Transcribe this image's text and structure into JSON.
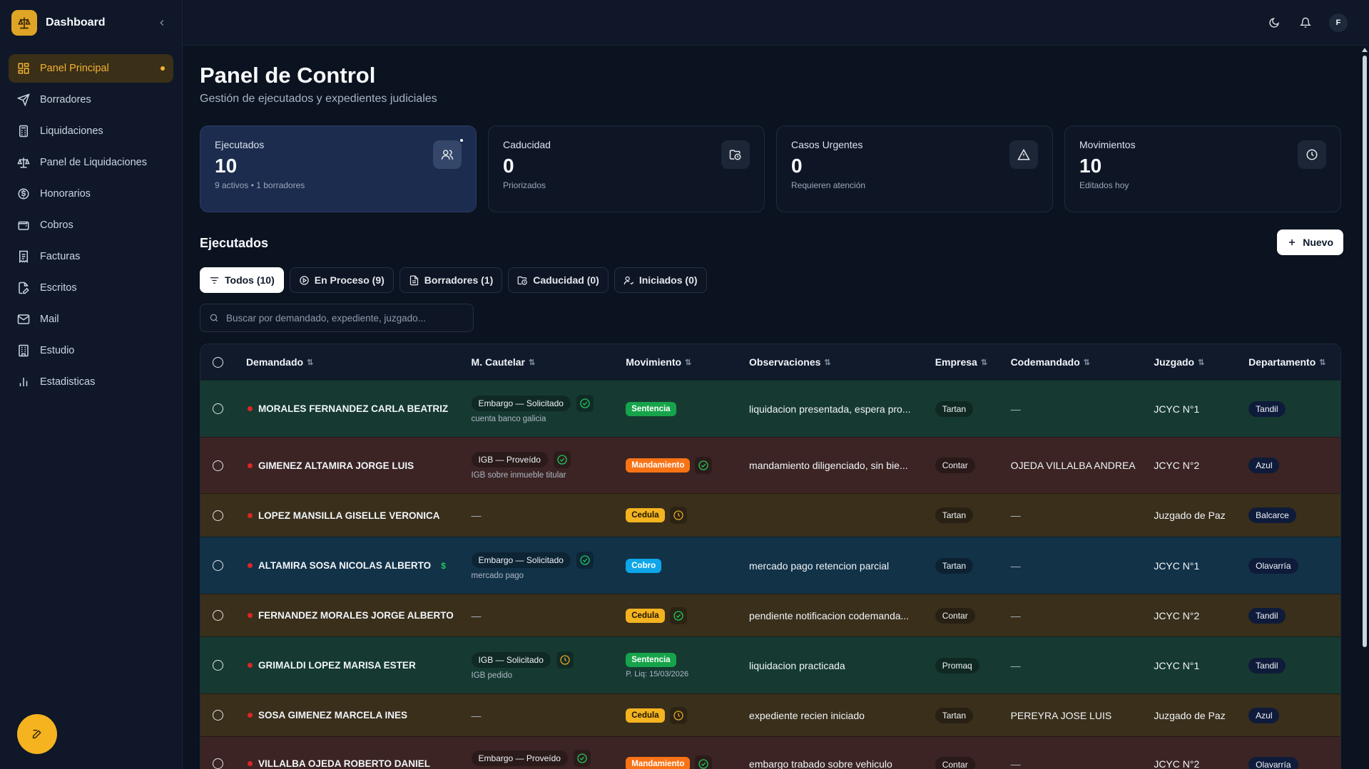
{
  "sidebar": {
    "brand": "Dashboard",
    "items": [
      {
        "label": "Panel Principal",
        "icon": "grid-icon"
      },
      {
        "label": "Borradores",
        "icon": "send-icon"
      },
      {
        "label": "Liquidaciones",
        "icon": "calculator-icon"
      },
      {
        "label": "Panel de Liquidaciones",
        "icon": "scale-icon"
      },
      {
        "label": "Honorarios",
        "icon": "dollar-circle-icon"
      },
      {
        "label": "Cobros",
        "icon": "wallet-icon"
      },
      {
        "label": "Facturas",
        "icon": "receipt-icon"
      },
      {
        "label": "Escritos",
        "icon": "file-pen-icon"
      },
      {
        "label": "Mail",
        "icon": "mail-icon"
      },
      {
        "label": "Estudio",
        "icon": "building-icon"
      },
      {
        "label": "Estadisticas",
        "icon": "bar-chart-icon"
      }
    ]
  },
  "topbar": {
    "avatar": "F"
  },
  "page": {
    "title": "Panel de Control",
    "subtitle": "Gestión de ejecutados y expedientes judiciales"
  },
  "stats": [
    {
      "label": "Ejecutados",
      "value": "10",
      "sub": "9 activos • 1 borradores"
    },
    {
      "label": "Caducidad",
      "value": "0",
      "sub": "Priorizados"
    },
    {
      "label": "Casos Urgentes",
      "value": "0",
      "sub": "Requieren atención"
    },
    {
      "label": "Movimientos",
      "value": "10",
      "sub": "Editados hoy"
    }
  ],
  "section": {
    "title": "Ejecutados",
    "new_label": "Nuevo"
  },
  "filters": [
    {
      "label": "Todos (10)"
    },
    {
      "label": "En Proceso (9)"
    },
    {
      "label": "Borradores (1)"
    },
    {
      "label": "Caducidad (0)"
    },
    {
      "label": "Iniciados (0)"
    }
  ],
  "search": {
    "placeholder": "Buscar por demandado, expediente, juzgado..."
  },
  "table": {
    "headers": [
      "Demandado",
      "M. Cautelar",
      "Movimiento",
      "Observaciones",
      "Empresa",
      "Codemandado",
      "Juzgado",
      "Departamento"
    ],
    "rows": [
      {
        "demandado": "MORALES FERNANDEZ CARLA BEATRIZ",
        "cautelar": "Embargo — Solicitado",
        "cautelar_sub": "cuenta banco galicia",
        "movimiento": "Sentencia",
        "mov_sub": "",
        "observaciones": "liquidacion presentada, espera pro...",
        "empresa": "Tartan",
        "codemandado": "—",
        "juzgado": "JCYC N°1",
        "departamento": "Tandil"
      },
      {
        "demandado": "GIMENEZ ALTAMIRA JORGE LUIS",
        "cautelar": "IGB — Proveído",
        "cautelar_sub": "IGB sobre inmueble titular",
        "movimiento": "Mandamiento",
        "mov_sub": "",
        "observaciones": "mandamiento diligenciado, sin bie...",
        "empresa": "Contar",
        "codemandado": "OJEDA VILLALBA ANDREA",
        "juzgado": "JCYC N°2",
        "departamento": "Azul"
      },
      {
        "demandado": "LOPEZ MANSILLA GISELLE VERONICA",
        "cautelar": "—",
        "cautelar_sub": "",
        "movimiento": "Cedula",
        "mov_sub": "",
        "observaciones": "",
        "empresa": "Tartan",
        "codemandado": "—",
        "juzgado": "Juzgado de Paz",
        "departamento": "Balcarce"
      },
      {
        "demandado": "ALTAMIRA SOSA NICOLAS ALBERTO",
        "dollar": "$",
        "cautelar": "Embargo — Solicitado",
        "cautelar_sub": "mercado pago",
        "movimiento": "Cobro",
        "mov_sub": "",
        "observaciones": "mercado pago retencion parcial",
        "empresa": "Tartan",
        "codemandado": "—",
        "juzgado": "JCYC N°1",
        "departamento": "Olavarría"
      },
      {
        "demandado": "FERNANDEZ MORALES JORGE ALBERTO",
        "cautelar": "—",
        "cautelar_sub": "",
        "movimiento": "Cedula",
        "mov_sub": "",
        "observaciones": "pendiente notificacion codemanda...",
        "empresa": "Contar",
        "codemandado": "—",
        "juzgado": "JCYC N°2",
        "departamento": "Tandil"
      },
      {
        "demandado": "GRIMALDI LOPEZ MARISA ESTER",
        "cautelar": "IGB — Solicitado",
        "cautelar_sub": "IGB pedido",
        "movimiento": "Sentencia",
        "mov_sub": "P. Liq: 15/03/2026",
        "observaciones": "liquidacion practicada",
        "empresa": "Promaq",
        "codemandado": "—",
        "juzgado": "JCYC N°1",
        "departamento": "Tandil"
      },
      {
        "demandado": "SOSA GIMENEZ MARCELA INES",
        "cautelar": "—",
        "cautelar_sub": "",
        "movimiento": "Cedula",
        "mov_sub": "",
        "observaciones": "expediente recien iniciado",
        "empresa": "Tartan",
        "codemandado": "PEREYRA JOSE LUIS",
        "juzgado": "Juzgado de Paz",
        "departamento": "Azul"
      },
      {
        "demandado": "VILLALBA OJEDA ROBERTO DANIEL",
        "cautelar": "Embargo — Proveído",
        "cautelar_sub": "",
        "movimiento": "Mandamiento",
        "mov_sub": "",
        "observaciones": "embargo trabado sobre vehiculo",
        "empresa": "Contar",
        "codemandado": "—",
        "juzgado": "JCYC N°2",
        "departamento": "Olavarría"
      }
    ]
  }
}
